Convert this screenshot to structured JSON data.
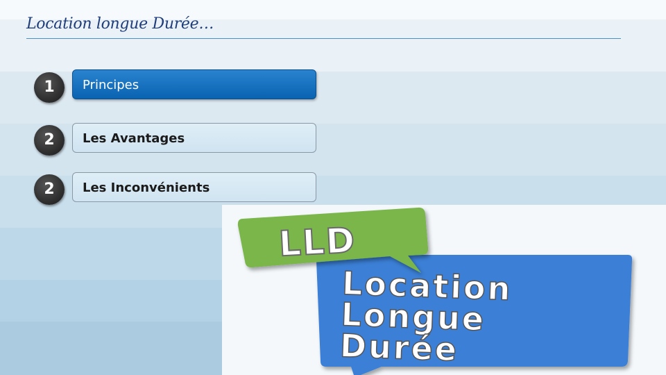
{
  "slide": {
    "title": "Location longue Durée…"
  },
  "menu": {
    "items": [
      {
        "number": "1",
        "label": "Principes",
        "active": true
      },
      {
        "number": "2",
        "label": "Les Avantages",
        "active": false
      },
      {
        "number": "2",
        "label": "Les Inconvénients",
        "active": false
      }
    ]
  },
  "image": {
    "logo_text": "LLD",
    "line1": "Location",
    "line2": "Longue",
    "line3": "Durée"
  },
  "colors": {
    "accent_blue": "#0a63b0",
    "logo_green": "#7ab648",
    "logo_blue": "#3a7fd6"
  }
}
